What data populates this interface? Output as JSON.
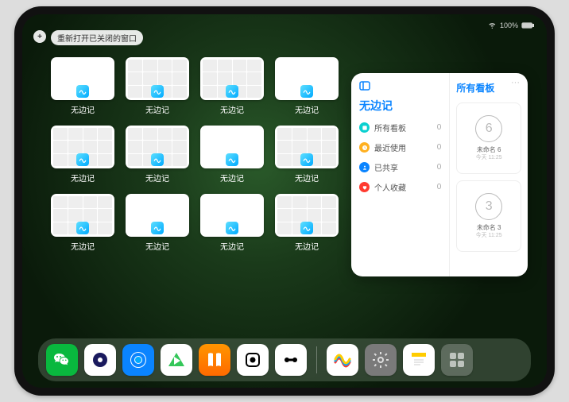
{
  "status": {
    "battery": "100%"
  },
  "topbar": {
    "plus": "+",
    "reopen_label": "重新打开已关闭的窗口"
  },
  "app_tile_label": "无边记",
  "tile_variants": [
    "blank",
    "calendar",
    "calendar",
    "blank",
    "calendar",
    "calendar",
    "blank",
    "calendar",
    "calendar",
    "blank",
    "blank",
    "calendar"
  ],
  "panel": {
    "left_title": "无边记",
    "nav": [
      {
        "label": "所有看板",
        "count": "0",
        "color": "#0ad0d0"
      },
      {
        "label": "最近使用",
        "count": "0",
        "color": "#ffb020"
      },
      {
        "label": "已共享",
        "count": "0",
        "color": "#0a84ff"
      },
      {
        "label": "个人收藏",
        "count": "0",
        "color": "#ff3b30"
      }
    ],
    "right_title": "所有看板",
    "overflow": "···",
    "boards": [
      {
        "sketch": "6",
        "name": "未命名 6",
        "sub": "今天 11:25"
      },
      {
        "sketch": "3",
        "name": "未命名 3",
        "sub": "今天 11:25"
      }
    ]
  },
  "dock": [
    {
      "name": "wechat",
      "bg": "#09b83e"
    },
    {
      "name": "quark",
      "bg": "#ffffff"
    },
    {
      "name": "qqbrowser",
      "bg": "#0a84ff"
    },
    {
      "name": "media",
      "bg": "#ffffff"
    },
    {
      "name": "books",
      "bg": "linear-gradient(#ff9500,#ff6a00)"
    },
    {
      "name": "dice",
      "bg": "#ffffff"
    },
    {
      "name": "connect",
      "bg": "#ffffff"
    },
    {
      "name": "spacer",
      "bg": ""
    },
    {
      "name": "freeform",
      "bg": "#ffffff"
    },
    {
      "name": "settings",
      "bg": "#7a7a7a"
    },
    {
      "name": "notes",
      "bg": "#ffffff"
    },
    {
      "name": "library",
      "bg": "rgba(255,255,255,.22)"
    }
  ]
}
